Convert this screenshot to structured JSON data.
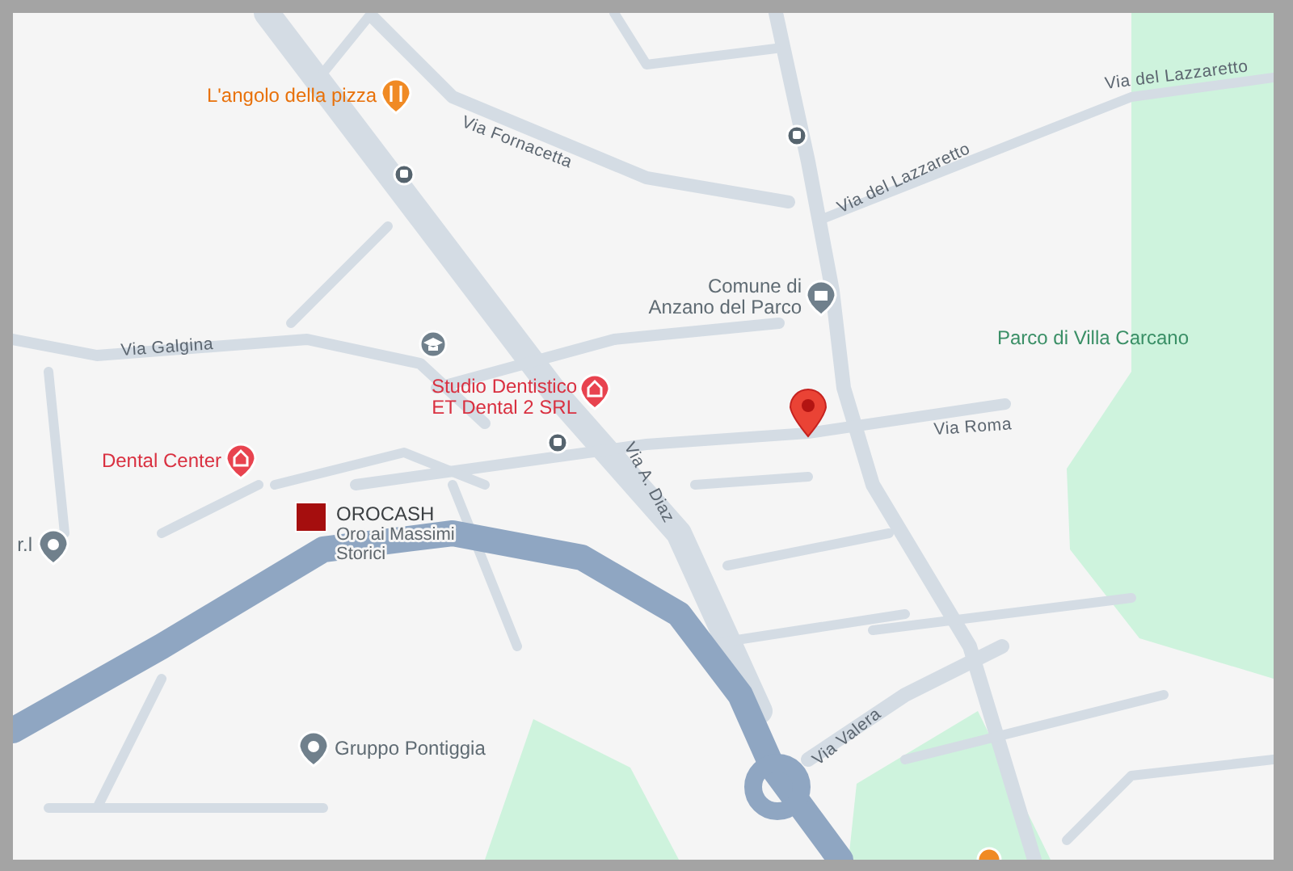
{
  "map": {
    "streets": [
      {
        "label": "Via Fornacetta"
      },
      {
        "label": "Via del Lazzaretto"
      },
      {
        "label": "Via del Lazzaretto"
      },
      {
        "label": "Via Galgina"
      },
      {
        "label": "Via Roma"
      },
      {
        "label": "Via A. Diaz"
      },
      {
        "label": "Via Valera"
      }
    ],
    "places": [
      {
        "kind": "restaurant",
        "lines": [
          "L'angolo della pizza"
        ]
      },
      {
        "kind": "dental",
        "lines": [
          "Studio Dentistico",
          "ET Dental 2 SRL"
        ]
      },
      {
        "kind": "dental",
        "lines": [
          "Dental Center"
        ]
      },
      {
        "kind": "generic",
        "lines": [
          "r.l"
        ]
      },
      {
        "kind": "shop",
        "lines": [
          "OROCASH"
        ],
        "subtitle": [
          "Oro ai Massimi",
          "Storici"
        ]
      },
      {
        "kind": "generic",
        "lines": [
          "Gruppo Pontiggia"
        ]
      },
      {
        "kind": "civic",
        "lines": [
          "Comune di",
          "Anzano del Parco"
        ]
      },
      {
        "kind": "park",
        "lines": [
          "Parco di Villa Carcano"
        ]
      }
    ]
  }
}
